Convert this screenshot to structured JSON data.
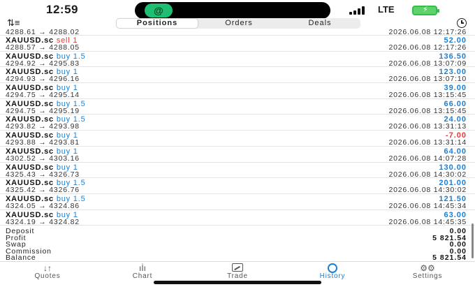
{
  "status_bar": {
    "time": "12:59",
    "network": "LTE",
    "app_glyph": "@"
  },
  "toolbar": {
    "sort_icon": "⇅≡",
    "tabs": [
      {
        "label": "Positions",
        "active": true
      },
      {
        "label": "Orders",
        "active": false
      },
      {
        "label": "Deals",
        "active": false
      }
    ]
  },
  "first_row": {
    "prices": "4288.61 → 4288.02",
    "datetime": "2026.06.08 12:17:26"
  },
  "deals": [
    {
      "symbol": "XAUUSD.sc",
      "side": "sell",
      "side_label": "sell 1",
      "profit": "52.00",
      "prices": "4288.57 → 4288.05",
      "datetime": "2026.06.08 12:17:26"
    },
    {
      "symbol": "XAUUSD.sc",
      "side": "buy",
      "side_label": "buy 1.5",
      "profit": "136.50",
      "prices": "4294.92 → 4295.83",
      "datetime": "2026.06.08 13:07:09"
    },
    {
      "symbol": "XAUUSD.sc",
      "side": "buy",
      "side_label": "buy 1",
      "profit": "123.00",
      "prices": "4294.93 → 4296.16",
      "datetime": "2026.06.08 13:07:10"
    },
    {
      "symbol": "XAUUSD.sc",
      "side": "buy",
      "side_label": "buy 1",
      "profit": "39.00",
      "prices": "4294.75 → 4295.14",
      "datetime": "2026.06.08 13:15:45"
    },
    {
      "symbol": "XAUUSD.sc",
      "side": "buy",
      "side_label": "buy 1.5",
      "profit": "66.00",
      "prices": "4294.75 → 4295.19",
      "datetime": "2026.06.08 13:15:45"
    },
    {
      "symbol": "XAUUSD.sc",
      "side": "buy",
      "side_label": "buy 1.5",
      "profit": "24.00",
      "prices": "4293.82 → 4293.98",
      "datetime": "2026.06.08 13:31:13"
    },
    {
      "symbol": "XAUUSD.sc",
      "side": "buy",
      "side_label": "buy 1",
      "profit": "-7.00",
      "prices": "4293.88 → 4293.81",
      "datetime": "2026.06.08 13:31:14"
    },
    {
      "symbol": "XAUUSD.sc",
      "side": "buy",
      "side_label": "buy 1",
      "profit": "64.00",
      "prices": "4302.52 → 4303.16",
      "datetime": "2026.06.08 14:07:28"
    },
    {
      "symbol": "XAUUSD.sc",
      "side": "buy",
      "side_label": "buy 1",
      "profit": "130.00",
      "prices": "4325.43 → 4326.73",
      "datetime": "2026.06.08 14:30:02"
    },
    {
      "symbol": "XAUUSD.sc",
      "side": "buy",
      "side_label": "buy 1.5",
      "profit": "201.00",
      "prices": "4325.42 → 4326.76",
      "datetime": "2026.06.08 14:30:02"
    },
    {
      "symbol": "XAUUSD.sc",
      "side": "buy",
      "side_label": "buy 1.5",
      "profit": "121.50",
      "prices": "4324.05 → 4324.86",
      "datetime": "2026.06.08 14:45:34"
    },
    {
      "symbol": "XAUUSD.sc",
      "side": "buy",
      "side_label": "buy 1",
      "profit": "63.00",
      "prices": "4324.19 → 4324.82",
      "datetime": "2026.06.08 14:45:35"
    }
  ],
  "summary": [
    {
      "label": "Deposit",
      "value": "0.00"
    },
    {
      "label": "Profit",
      "value": "5 821.54"
    },
    {
      "label": "Swap",
      "value": "0.00"
    },
    {
      "label": "Commission",
      "value": "0.00"
    },
    {
      "label": "Balance",
      "value": "5 821.54"
    }
  ],
  "tabbar": [
    {
      "name": "quotes",
      "label": "Quotes",
      "icon": "↓↑",
      "active": false
    },
    {
      "name": "chart",
      "label": "Chart",
      "icon": "ıİı",
      "active": false
    },
    {
      "name": "trade",
      "label": "Trade",
      "icon": "",
      "active": false
    },
    {
      "name": "history",
      "label": "History",
      "icon": "",
      "active": true
    },
    {
      "name": "settings",
      "label": "Settings",
      "icon": "⚙⚙",
      "active": false
    }
  ],
  "colors": {
    "buy": "#1a7fd4",
    "sell": "#e53935",
    "active_tab": "#1a7fd4"
  }
}
